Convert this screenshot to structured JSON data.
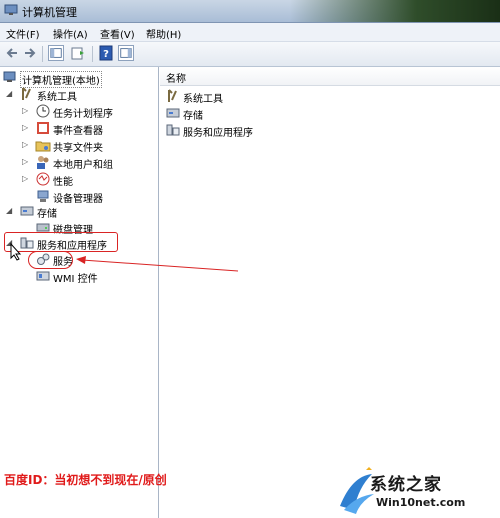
{
  "window": {
    "title": "计算机管理"
  },
  "menu": [
    "文件(F)",
    "操作(A)",
    "查看(V)",
    "帮助(H)"
  ],
  "tree": {
    "root": "计算机管理(本地)",
    "system_tools": "系统工具",
    "task_scheduler": "任务计划程序",
    "event_viewer": "事件查看器",
    "shared_folders": "共享文件夹",
    "local_users": "本地用户和组",
    "performance": "性能",
    "device_manager": "设备管理器",
    "storage": "存储",
    "disk_management": "磁盘管理",
    "services_apps": "服务和应用程序",
    "services": "服务",
    "wmi_control": "WMI 控件"
  },
  "list": {
    "column_header": "名称",
    "items": [
      "系统工具",
      "存储",
      "服务和应用程序"
    ]
  },
  "overlay": {
    "watermark": "百度ID：当初想不到现在/原创",
    "logo_main": "系统之家",
    "logo_sub": "Win10net.com"
  },
  "colors": {
    "annotation_red": "#d92424"
  }
}
